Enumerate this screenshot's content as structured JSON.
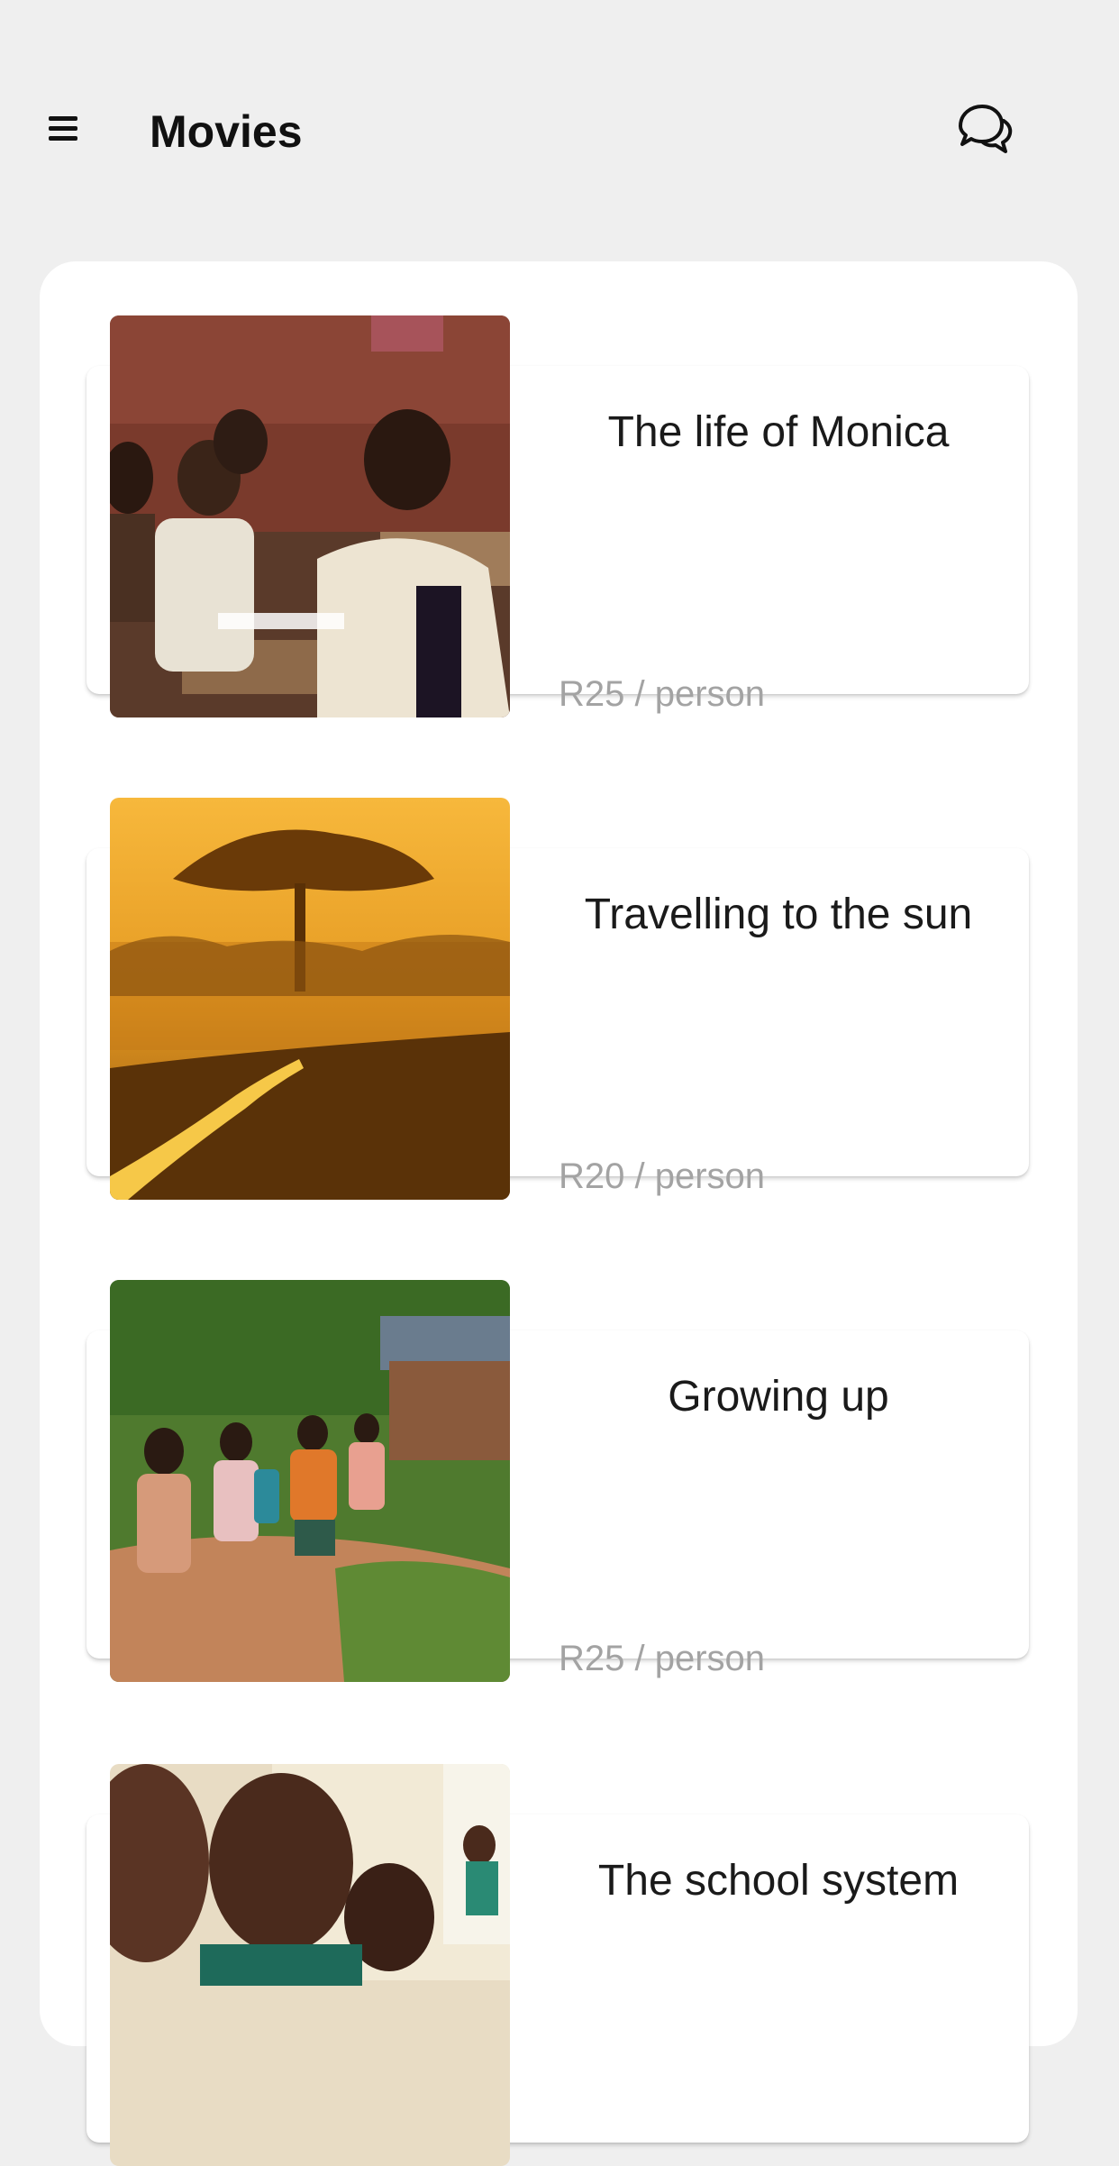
{
  "header": {
    "title": "Movies",
    "menu_icon": "hamburger-menu-icon",
    "chat_icon": "chat-bubbles-icon"
  },
  "movies": [
    {
      "title": "The life of Monica",
      "price": "R25 / person",
      "image": "classroom-students-photo"
    },
    {
      "title": "Travelling to the sun",
      "price": "R20 / person",
      "image": "sunset-savanna-photo"
    },
    {
      "title": "Growing up",
      "price": "R25 / person",
      "image": "children-running-photo"
    },
    {
      "title": "The school system",
      "price": "",
      "image": "children-writing-photo"
    }
  ],
  "colors": {
    "background": "#efefef",
    "card": "#ffffff",
    "title_text": "#111111",
    "price_text": "#a3a3a3"
  }
}
